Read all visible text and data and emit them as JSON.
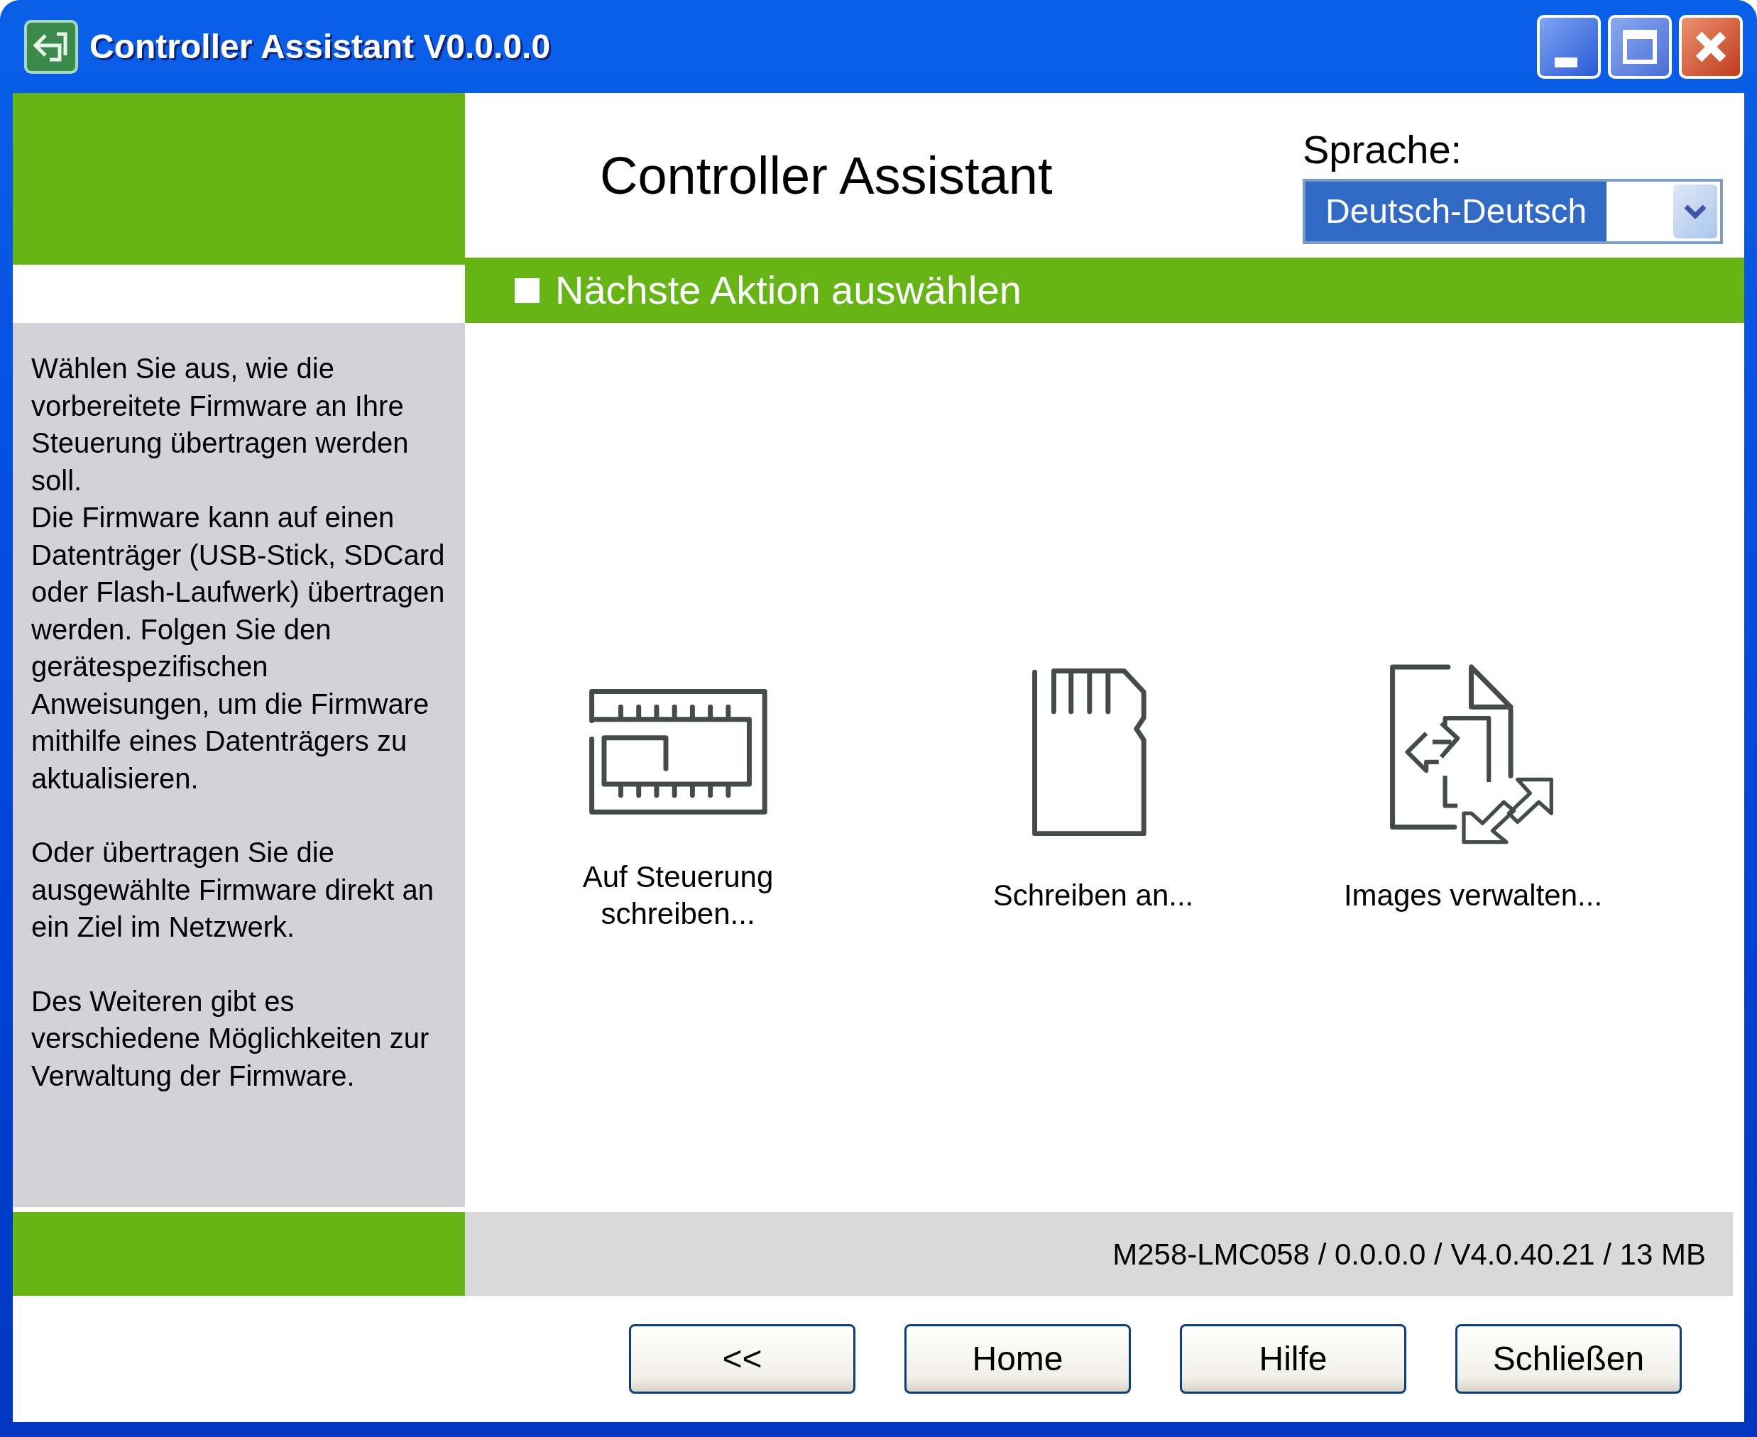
{
  "window": {
    "title": "Controller Assistant V0.0.0.0",
    "controls": [
      {
        "kind": "minimize"
      },
      {
        "kind": "maximize"
      },
      {
        "kind": "close"
      }
    ]
  },
  "header": {
    "title": "Controller Assistant",
    "language_label": "Sprache:",
    "language": {
      "value": "Deutsch-Deutsch",
      "highlighted": true
    }
  },
  "section_title": "Nächste Aktion auswählen",
  "description": [
    {
      "paragraphs": [
        "Wählen Sie aus, wie die vorbereitete Firmware an Ihre Steuerung übertragen werden soll.",
        "Die Firmware kann auf einen Datenträger (USB-Stick, SDCard oder Flash-Laufwerk) übertragen werden. Folgen Sie den gerätespezifischen Anweisungen, um die Firmware mithilfe eines Datenträgers zu aktualisieren."
      ]
    },
    {
      "paragraphs": [
        "Oder übertragen Sie die ausgewählte Firmware direkt an ein Ziel im Netzwerk."
      ]
    },
    {
      "paragraphs": [
        "Des Weiteren gibt es verschiedene Möglichkeiten zur Verwaltung der Firmware."
      ]
    }
  ],
  "actions": [
    {
      "kind": "chip",
      "label": "Auf Steuerung schreiben..."
    },
    {
      "kind": "sd-card",
      "label": "Schreiben an..."
    },
    {
      "kind": "images",
      "label": "Images verwalten..."
    }
  ],
  "status_bar": "M258-LMC058 / 0.0.0.0 / V4.0.40.21 / 13 MB",
  "buttons": [
    "<<",
    "Home",
    "Hilfe",
    "Schließen"
  ]
}
